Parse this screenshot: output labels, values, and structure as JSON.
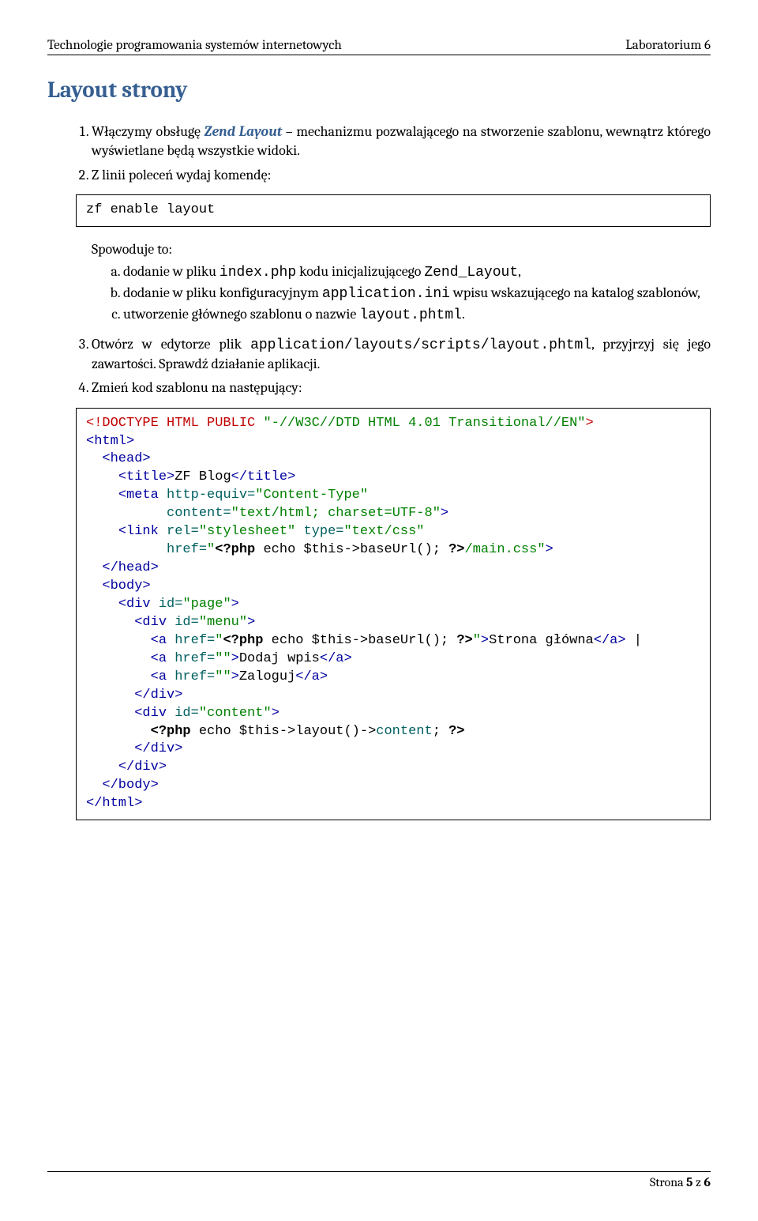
{
  "header": {
    "left": "Technologie programowania systemów internetowych",
    "right": "Laboratorium 6"
  },
  "title": "Layout strony",
  "step1": {
    "before": "Włączymy obsługę ",
    "em": "Zend Layout",
    "after": " – mechanizmu pozwalającego na stworzenie szablonu, wewnątrz którego wyświetlane będą wszystkie widoki."
  },
  "step2": "Z linii poleceń wydaj komendę:",
  "codebox1": "zf enable layout",
  "sub_intro": "Spowoduje to:",
  "sub": {
    "a": {
      "p1": "dodanie w pliku ",
      "c1": "index.php",
      "p2": " kodu inicjalizującego ",
      "c2": "Zend_Layout",
      "p3": ","
    },
    "b": {
      "p1": "dodanie w pliku konfiguracyjnym ",
      "c1": "application.ini",
      "p2": " wpisu wskazującego na katalog szablonów,"
    },
    "c": {
      "p1": "utworzenie głównego szablonu o nazwie ",
      "c1": "layout.phtml",
      "p2": "."
    }
  },
  "step3": {
    "p1": "Otwórz w edytorze plik ",
    "c1": "application/layouts/scripts/layout.phtml",
    "p2": ", przyjrzyj się jego zawartości. Sprawdź działanie aplikacji."
  },
  "step4": "Zmień kod szablonu na następujący:",
  "code2": {
    "l1a": "<!DOCTYPE HTML PUBLIC ",
    "l1b": "\"-//W3C//DTD HTML 4.01 Transitional//EN\"",
    "l1c": ">",
    "l2": "<html>",
    "l3": "  <head>",
    "l4a": "    <title>",
    "l4b": "ZF Blog",
    "l4c": "</title>",
    "l5a": "    <meta",
    "l5b": " http-equiv=",
    "l5c": "\"Content-Type\"",
    "l6a": "          content=",
    "l6b": "\"text/html; charset=UTF-8\"",
    "l6c": ">",
    "l7a": "    <link",
    "l7b": " rel=",
    "l7c": "\"stylesheet\"",
    "l7d": " type=",
    "l7e": "\"text/css\"",
    "l8a": "          href=",
    "l8b": "\"",
    "l8c": "<?php",
    "l8d": " echo $this->baseUrl(); ",
    "l8e": "?>",
    "l8f": "/main.css\"",
    "l8g": ">",
    "l9": "  </head>",
    "l10": "  <body>",
    "l11a": "    <div",
    "l11b": " id=",
    "l11c": "\"page\"",
    "l11d": ">",
    "l12a": "      <div",
    "l12b": " id=",
    "l12c": "\"menu\"",
    "l12d": ">",
    "l13a": "        <a",
    "l13b": " href=",
    "l13c": "\"",
    "l13d": "<?php",
    "l13e": " echo $this->baseUrl(); ",
    "l13f": "?>",
    "l13g": "\"",
    "l13h": ">",
    "l13i": "Strona główna",
    "l13j": "</a>",
    "l13k": " |",
    "l14a": "        <a",
    "l14b": " href=",
    "l14c": "\"\"",
    "l14d": ">",
    "l14e": "Dodaj wpis",
    "l14f": "</a>",
    "l15a": "        <a",
    "l15b": " href=",
    "l15c": "\"\"",
    "l15d": ">",
    "l15e": "Zaloguj",
    "l15f": "</a>",
    "l16": "      </div>",
    "l17a": "      <div",
    "l17b": " id=",
    "l17c": "\"content\"",
    "l17d": ">",
    "l18a": "        ",
    "l18b": "<?php",
    "l18c": " echo $this->layout()->",
    "l18d": "content",
    "l18e": "; ",
    "l18f": "?>",
    "l19": "      </div>",
    "l20": "    </div>",
    "l21": "  </body>",
    "l22": "</html>"
  },
  "footer": {
    "p1": "Strona ",
    "b": "5",
    "p2": " z ",
    "t": "6"
  }
}
